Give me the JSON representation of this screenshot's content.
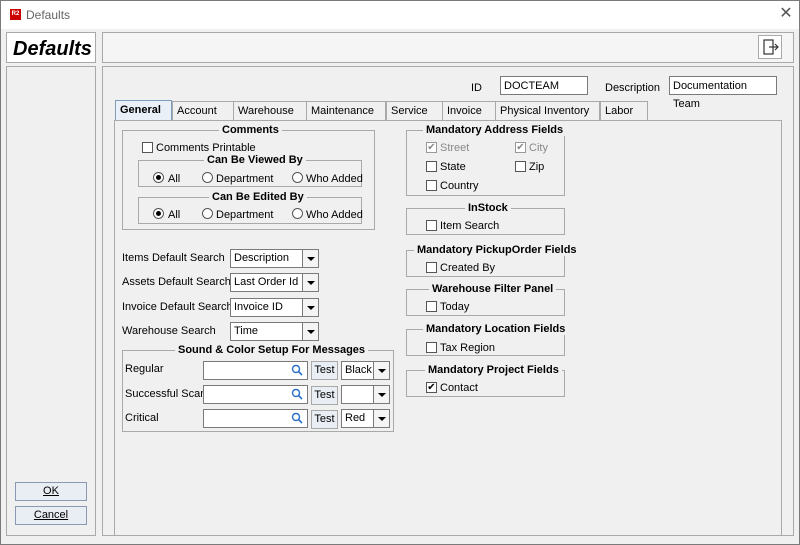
{
  "window": {
    "app_icon_text": "R2",
    "title": "Defaults",
    "close_glyph": "✕"
  },
  "header": {
    "heading": "Defaults",
    "exit_icon": "exit-icon"
  },
  "sidebar": {
    "ok_label": "OK",
    "cancel_label": "Cancel"
  },
  "form": {
    "id_label": "ID",
    "id_value": "DOCTEAM",
    "description_label": "Description",
    "description_value": "Documentation Team"
  },
  "tabs": [
    "General",
    "Account",
    "Warehouse",
    "Maintenance",
    "Service",
    "Invoice",
    "Physical Inventory",
    "Labor"
  ],
  "active_tab": "General",
  "comments": {
    "title": "Comments",
    "printable_label": "Comments Printable",
    "printable_checked": false,
    "viewed_by": {
      "title": "Can Be Viewed By",
      "options": [
        "All",
        "Department",
        "Who Added"
      ],
      "selected": "All"
    },
    "edited_by": {
      "title": "Can Be Edited By",
      "options": [
        "All",
        "Department",
        "Who Added"
      ],
      "selected": "All"
    }
  },
  "searches": [
    {
      "label": "Items Default Search",
      "value": "Description"
    },
    {
      "label": "Assets Default Search",
      "value": "Last Order Id"
    },
    {
      "label": "Invoice Default Search",
      "value": "Invoice ID"
    },
    {
      "label": "Warehouse Search",
      "value": "Time"
    }
  ],
  "sound": {
    "title": "Sound & Color Setup For Messages",
    "test_label": "Test",
    "rows": [
      {
        "label": "Regular",
        "value": "",
        "color": "Black"
      },
      {
        "label": "Successful Scan",
        "value": "",
        "color": ""
      },
      {
        "label": "Critical",
        "value": "",
        "color": "Red"
      }
    ]
  },
  "address": {
    "title": "Mandatory Address Fields",
    "street": "Street",
    "street_checked": true,
    "city": "City",
    "city_checked": true,
    "state": "State",
    "state_checked": false,
    "zip": "Zip",
    "zip_checked": false,
    "country": "Country",
    "country_checked": false
  },
  "instock": {
    "title": "InStock",
    "item_search": "Item Search",
    "checked": false
  },
  "pickup": {
    "title": "Mandatory PickupOrder Fields",
    "created_by": "Created By",
    "checked": false
  },
  "warehouse_filter": {
    "title": "Warehouse Filter Panel",
    "today": "Today",
    "checked": false
  },
  "location": {
    "title": "Mandatory Location Fields",
    "tax_region": "Tax Region",
    "checked": false
  },
  "project": {
    "title": "Mandatory Project Fields",
    "contact": "Contact",
    "checked": true
  },
  "check_glyph": "✔"
}
